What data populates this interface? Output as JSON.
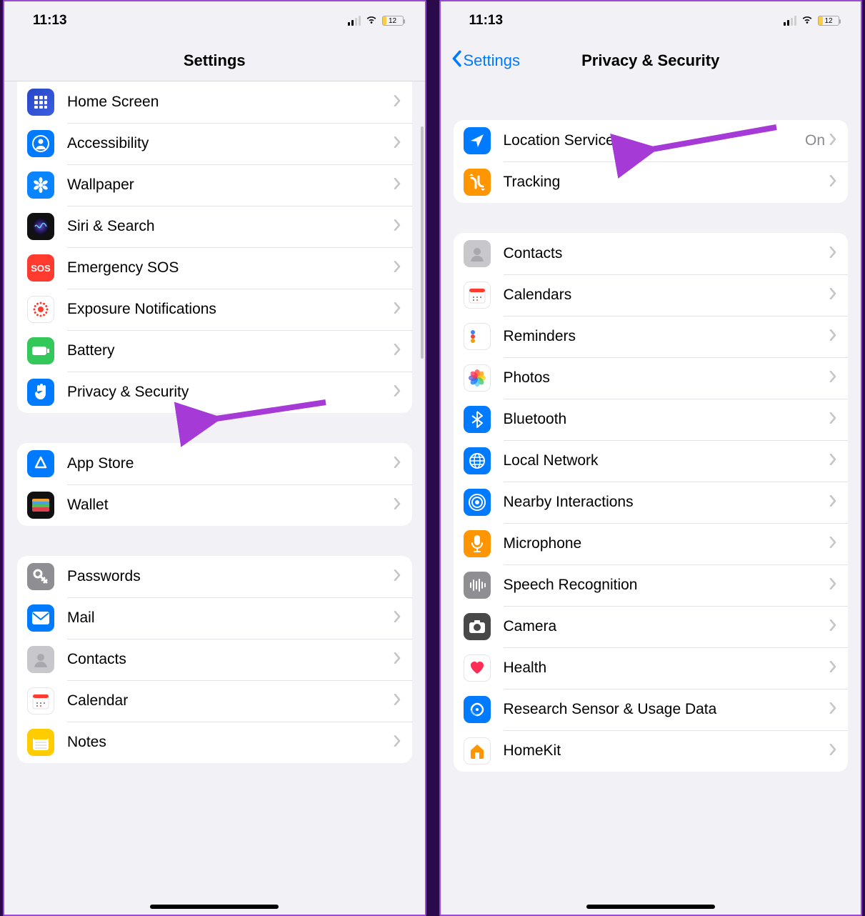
{
  "status": {
    "time": "11:13",
    "battery_text": "12"
  },
  "left": {
    "nav_title": "Settings",
    "groups": [
      {
        "rows": [
          {
            "id": "home-screen",
            "label": "Home Screen",
            "icon": "grid",
            "bg": "bg-multi"
          },
          {
            "id": "accessibility",
            "label": "Accessibility",
            "icon": "person-circle",
            "bg": "bg-blue"
          },
          {
            "id": "wallpaper",
            "label": "Wallpaper",
            "icon": "flower",
            "bg": "bg-teal"
          },
          {
            "id": "siri",
            "label": "Siri & Search",
            "icon": "siri",
            "bg": "bg-black"
          },
          {
            "id": "emergency-sos",
            "label": "Emergency SOS",
            "icon": "sos",
            "bg": "bg-red"
          },
          {
            "id": "exposure",
            "label": "Exposure Notifications",
            "icon": "sunburst",
            "bg": "bg-white"
          },
          {
            "id": "battery",
            "label": "Battery",
            "icon": "battery",
            "bg": "bg-green"
          },
          {
            "id": "privacy",
            "label": "Privacy & Security",
            "icon": "hand",
            "bg": "bg-blue"
          }
        ]
      },
      {
        "rows": [
          {
            "id": "app-store",
            "label": "App Store",
            "icon": "appstore",
            "bg": "bg-blue"
          },
          {
            "id": "wallet",
            "label": "Wallet",
            "icon": "wallet",
            "bg": "bg-black"
          }
        ]
      },
      {
        "rows": [
          {
            "id": "passwords",
            "label": "Passwords",
            "icon": "key",
            "bg": "bg-gray"
          },
          {
            "id": "mail",
            "label": "Mail",
            "icon": "mail",
            "bg": "bg-blue"
          },
          {
            "id": "contacts",
            "label": "Contacts",
            "icon": "contacts",
            "bg": "bg-grayL"
          },
          {
            "id": "calendar",
            "label": "Calendar",
            "icon": "calendar",
            "bg": "bg-white"
          },
          {
            "id": "notes",
            "label": "Notes",
            "icon": "notes",
            "bg": "bg-yellow"
          }
        ]
      }
    ]
  },
  "right": {
    "back_label": "Settings",
    "nav_title": "Privacy & Security",
    "groups": [
      {
        "rows": [
          {
            "id": "location",
            "label": "Location Services",
            "icon": "location",
            "bg": "bg-blue",
            "value": "On"
          },
          {
            "id": "tracking",
            "label": "Tracking",
            "icon": "tracking",
            "bg": "bg-orange"
          }
        ]
      },
      {
        "rows": [
          {
            "id": "contacts2",
            "label": "Contacts",
            "icon": "contacts",
            "bg": "bg-grayL"
          },
          {
            "id": "calendars2",
            "label": "Calendars",
            "icon": "calendar",
            "bg": "bg-white"
          },
          {
            "id": "reminders",
            "label": "Reminders",
            "icon": "reminders",
            "bg": "bg-white"
          },
          {
            "id": "photos",
            "label": "Photos",
            "icon": "photos",
            "bg": "bg-white"
          },
          {
            "id": "bluetooth",
            "label": "Bluetooth",
            "icon": "bluetooth",
            "bg": "bg-blue"
          },
          {
            "id": "local-net",
            "label": "Local Network",
            "icon": "globe",
            "bg": "bg-blue"
          },
          {
            "id": "nearby",
            "label": "Nearby Interactions",
            "icon": "nearby",
            "bg": "bg-blue"
          },
          {
            "id": "microphone",
            "label": "Microphone",
            "icon": "mic",
            "bg": "bg-orange"
          },
          {
            "id": "speech",
            "label": "Speech Recognition",
            "icon": "speech",
            "bg": "bg-gray"
          },
          {
            "id": "camera",
            "label": "Camera",
            "icon": "camera",
            "bg": "bg-darkgray"
          },
          {
            "id": "health",
            "label": "Health",
            "icon": "health",
            "bg": "bg-white"
          },
          {
            "id": "research",
            "label": "Research Sensor & Usage Data",
            "icon": "research",
            "bg": "bg-blue"
          },
          {
            "id": "homekit",
            "label": "HomeKit",
            "icon": "home",
            "bg": "bg-white"
          }
        ]
      }
    ]
  }
}
